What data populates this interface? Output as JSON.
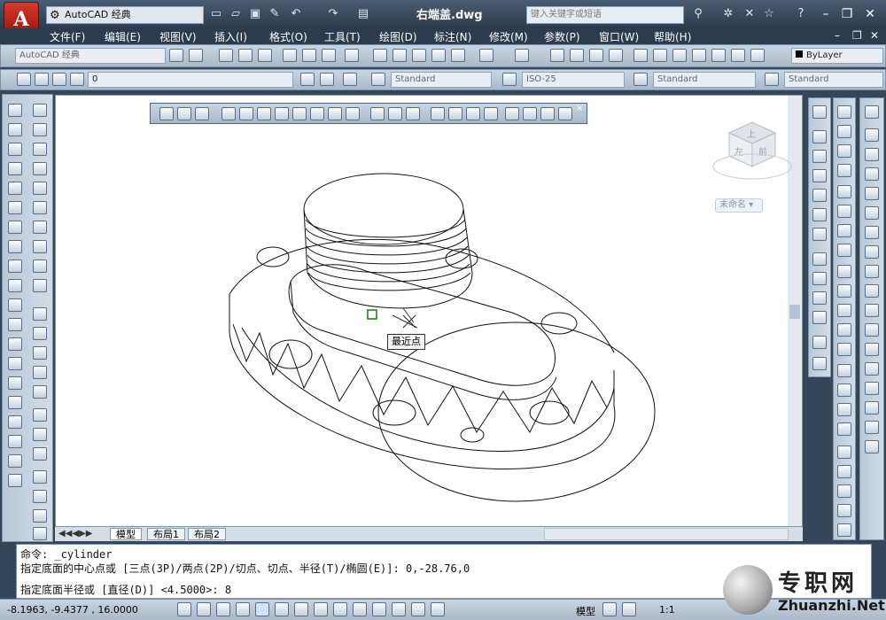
{
  "app": {
    "logo_letter": "A",
    "workspace": "AutoCAD 经典",
    "document_title": "右端盖.dwg",
    "search_placeholder": "键入关键字或短语"
  },
  "menus": [
    "文件(F)",
    "编辑(E)",
    "视图(V)",
    "插入(I)",
    "格式(O)",
    "工具(T)",
    "绘图(D)",
    "标注(N)",
    "修改(M)",
    "参数(P)",
    "窗口(W)",
    "帮助(H)"
  ],
  "toolbar_row1": {
    "workspace_dropdown": "AutoCAD 经典",
    "layer_dropdown": "ByLayer"
  },
  "toolbar_row2": {
    "layer_value": "0",
    "text_style": "Standard",
    "dim_style": "ISO-25",
    "table_style": "Standard",
    "multileader_style": "Standard"
  },
  "canvas": {
    "viewcube_top": "上",
    "viewcube_front": "左",
    "viewcube_right": "前",
    "viewcube_label": "未命名",
    "snap_tooltip": "最近点"
  },
  "tabs": [
    "模型",
    "布局1",
    "布局2"
  ],
  "command": {
    "line1": "命令: _cylinder",
    "line2": "指定底面的中心点或 [三点(3P)/两点(2P)/切点、切点、半径(T)/椭圆(E)]: 0,-28.76,0",
    "line3": "指定底面半径或 [直径(D)] <4.5000>: 8"
  },
  "status": {
    "coords": "-8.1963,  -9.4377 , 16.0000",
    "model": "模型",
    "scale": "1:1"
  },
  "watermark": {
    "cn": "专职网",
    "en": "Zhuanzhi.Net"
  },
  "colors": {
    "title_bg": "#2c3b4d",
    "canvas": "#ffffff",
    "logo_red": "#d9382c"
  }
}
